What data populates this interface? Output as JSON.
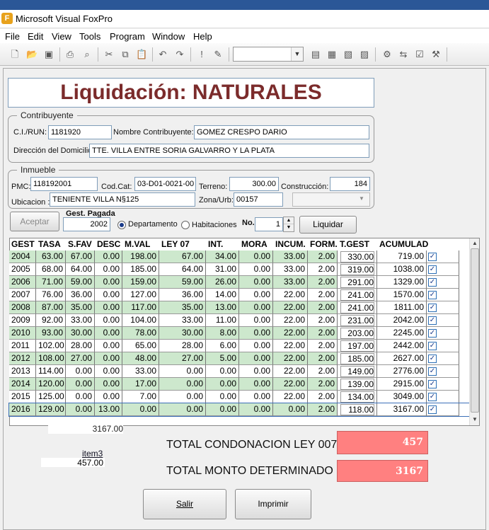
{
  "app": {
    "title": "Microsoft Visual FoxPro",
    "icon": "foxpro-logo-icon"
  },
  "menu": [
    "File",
    "Edit",
    "View",
    "Tools",
    "Program",
    "Window",
    "Help"
  ],
  "toolbar": {
    "icons": [
      "new-file-icon",
      "open-folder-icon",
      "save-icon",
      "print-icon",
      "print-preview-icon",
      "cut-icon",
      "copy-icon",
      "paste-icon",
      "undo-icon",
      "redo-icon",
      "run-icon",
      "modify-form-icon",
      "data-session-icon",
      "properties-icon",
      "code-window-icon",
      "form-designer-icon",
      "report-icon",
      "class-browser-icon",
      "form-control-icon",
      "builder-icon",
      "wrench-icon"
    ],
    "combo_value": ""
  },
  "form": {
    "title": "Liquidación: NATURALES",
    "contribuyente": {
      "group": "Contribuyente",
      "ci_label": "C.I./RUN:",
      "ci": "1181920",
      "nombre_label": "Nombre Contribuyente:",
      "nombre": "GOMEZ CRESPO DARIO",
      "dir_label": "Dirección del Domicilio",
      "dir": "TTE. VILLA ENTRE SORIA GALVARRO Y LA PLATA"
    },
    "inmueble": {
      "group": "Inmueble",
      "pmc_label": "PMC:",
      "pmc": "118192001",
      "codcat_label": "Cod.Cat:",
      "codcat": "03-D01-0021-00",
      "terreno_label": "Terreno:",
      "terreno": "300.00",
      "construccion_label": "Construcción:",
      "construccion": "184",
      "ubic_label": "Ubicacion :",
      "ubic": "TENIENTE VILLA N§125",
      "zona_label": "Zona/Urb:",
      "zona": "00157",
      "combo": ""
    },
    "controls": {
      "aceptar": "Aceptar",
      "gest_label": "Gest. Pagada",
      "gest": "2002",
      "radio1": "Departamento",
      "radio2": "Habitaciones",
      "no_label": "No.",
      "no": "1",
      "liquidar": "Liquidar"
    }
  },
  "grid": {
    "headers": [
      "GEST",
      "TASA",
      "S.FAV",
      "DESC",
      "M.VAL",
      "LEY 07",
      "INT.",
      "MORA",
      "INCUM.",
      "FORM.",
      "T.GEST",
      "ACUMULAD"
    ],
    "rows": [
      [
        "2004",
        "63.00",
        "67.00",
        "0.00",
        "198.00",
        "67.00",
        "34.00",
        "0.00",
        "33.00",
        "2.00",
        "330.00",
        "719.00"
      ],
      [
        "2005",
        "68.00",
        "64.00",
        "0.00",
        "185.00",
        "64.00",
        "31.00",
        "0.00",
        "33.00",
        "2.00",
        "319.00",
        "1038.00"
      ],
      [
        "2006",
        "71.00",
        "59.00",
        "0.00",
        "159.00",
        "59.00",
        "26.00",
        "0.00",
        "33.00",
        "2.00",
        "291.00",
        "1329.00"
      ],
      [
        "2007",
        "76.00",
        "36.00",
        "0.00",
        "127.00",
        "36.00",
        "14.00",
        "0.00",
        "22.00",
        "2.00",
        "241.00",
        "1570.00"
      ],
      [
        "2008",
        "87.00",
        "35.00",
        "0.00",
        "117.00",
        "35.00",
        "13.00",
        "0.00",
        "22.00",
        "2.00",
        "241.00",
        "1811.00"
      ],
      [
        "2009",
        "92.00",
        "33.00",
        "0.00",
        "104.00",
        "33.00",
        "11.00",
        "0.00",
        "22.00",
        "2.00",
        "231.00",
        "2042.00"
      ],
      [
        "2010",
        "93.00",
        "30.00",
        "0.00",
        "78.00",
        "30.00",
        "8.00",
        "0.00",
        "22.00",
        "2.00",
        "203.00",
        "2245.00"
      ],
      [
        "2011",
        "102.00",
        "28.00",
        "0.00",
        "65.00",
        "28.00",
        "6.00",
        "0.00",
        "22.00",
        "2.00",
        "197.00",
        "2442.00"
      ],
      [
        "2012",
        "108.00",
        "27.00",
        "0.00",
        "48.00",
        "27.00",
        "5.00",
        "0.00",
        "22.00",
        "2.00",
        "185.00",
        "2627.00"
      ],
      [
        "2013",
        "114.00",
        "0.00",
        "0.00",
        "33.00",
        "0.00",
        "0.00",
        "0.00",
        "22.00",
        "2.00",
        "149.00",
        "2776.00"
      ],
      [
        "2014",
        "120.00",
        "0.00",
        "0.00",
        "17.00",
        "0.00",
        "0.00",
        "0.00",
        "22.00",
        "2.00",
        "139.00",
        "2915.00"
      ],
      [
        "2015",
        "125.00",
        "0.00",
        "0.00",
        "7.00",
        "0.00",
        "0.00",
        "0.00",
        "22.00",
        "2.00",
        "134.00",
        "3049.00"
      ],
      [
        "2016",
        "129.00",
        "0.00",
        "13.00",
        "0.00",
        "0.00",
        "0.00",
        "0.00",
        "0.00",
        "2.00",
        "118.00",
        "3167.00"
      ]
    ],
    "checked": true
  },
  "below": {
    "sum": "3167.00",
    "item3": "item3",
    "item3_val": "457.00"
  },
  "totals": {
    "condonacion_label": "TOTAL CONDONACION LEY 007",
    "condonacion": "457",
    "monto_label": "TOTAL MONTO DETERMINADO",
    "monto": "3167"
  },
  "buttons": {
    "salir": "Salir",
    "imprimir": "Imprimir"
  },
  "colors": {
    "green_row": "#cde8cd",
    "title": "#7b2b2b",
    "total_bg": "#ff8080"
  }
}
